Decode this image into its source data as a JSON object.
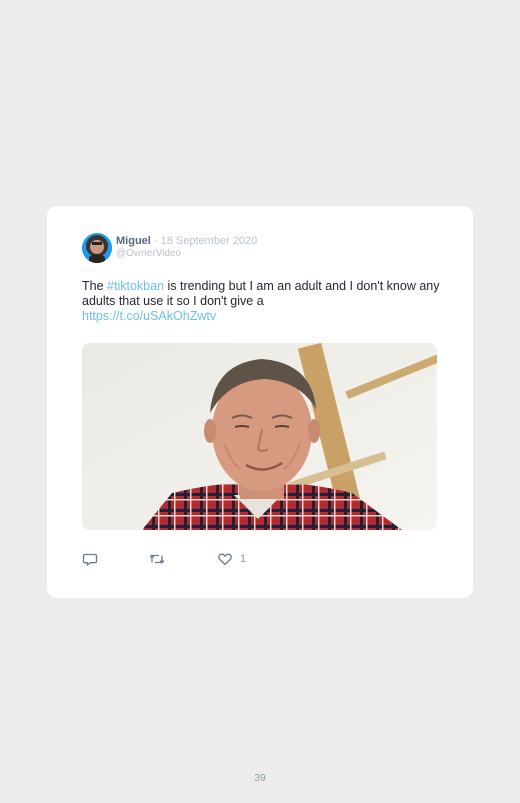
{
  "tweet": {
    "author_name": "Miguel",
    "separator": "·",
    "date": "18 September 2020",
    "handle": "@OwnerVideo",
    "text_before": "The ",
    "hashtag": "#tiktokban",
    "text_after": " is trending but I am an adult and I don't know any adults that use it so I don't give a",
    "link": "https://t.co/uSAkOhZwtv"
  },
  "actions": {
    "reply_icon": "comment-icon",
    "retweet_icon": "retweet-icon",
    "like_icon": "heart-icon",
    "like_count": "1"
  },
  "page": {
    "number": "39"
  },
  "colors": {
    "background": "#ececec",
    "card": "#ffffff",
    "link": "#6cc0ea",
    "author": "#55677e",
    "muted": "#b9c3cd"
  }
}
